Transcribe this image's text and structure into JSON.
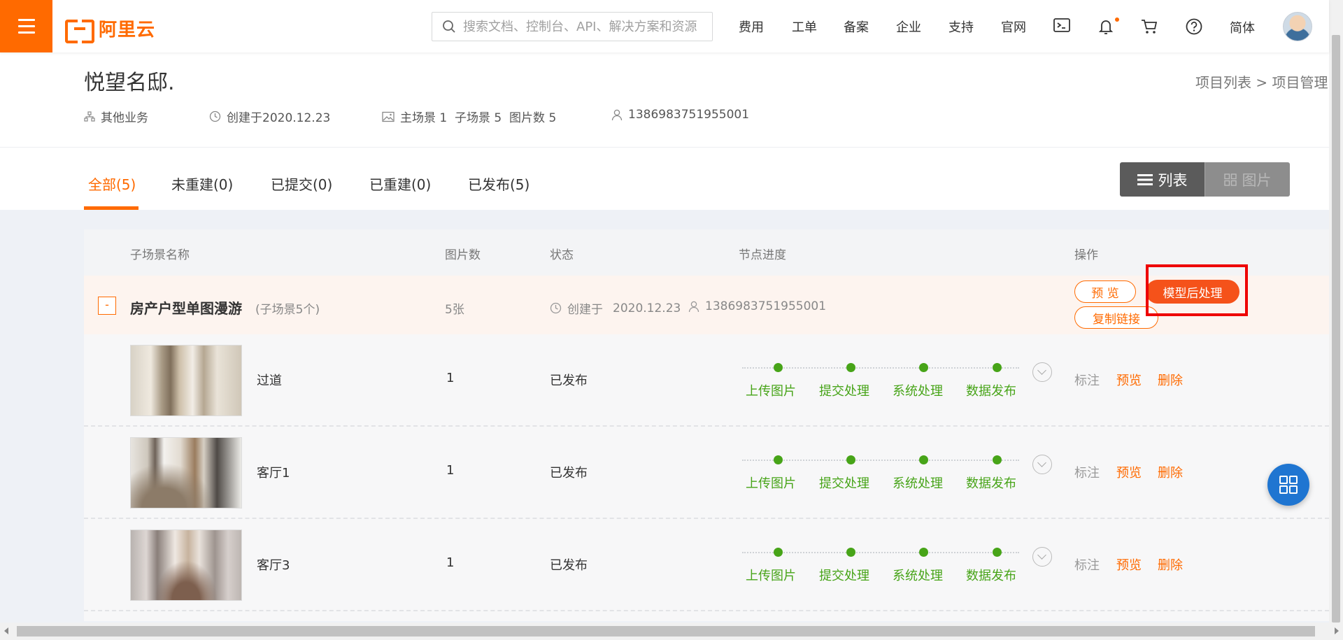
{
  "nav": {
    "logo_text": "阿里云",
    "search_placeholder": "搜索文档、控制台、API、解决方案和资源",
    "links": [
      "费用",
      "工单",
      "备案",
      "企业",
      "支持",
      "官网"
    ],
    "language": "简体",
    "icons": [
      "menu-icon",
      "search-icon",
      "terminal-icon",
      "bell-icon",
      "cart-icon",
      "help-icon",
      "avatar"
    ]
  },
  "project": {
    "title": "悦望名邸.",
    "breadcrumb": [
      "项目列表",
      ">",
      "项目管理"
    ],
    "type": "其他业务",
    "created": "创建于2020.12.23",
    "scenes": "主场景 1  子场景 5  图片数 5",
    "owner": "1386983751955001"
  },
  "tabs": {
    "items": [
      "全部(5)",
      "未重建(0)",
      "已提交(0)",
      "已重建(0)",
      "已发布(5)"
    ],
    "active": 0,
    "view_list": "列表",
    "view_grid": "图片"
  },
  "table": {
    "headers": [
      "子场景名称",
      "图片数",
      "状态",
      "节点进度",
      "操作"
    ],
    "group": {
      "toggle": "-",
      "name": "房产户型单图漫游",
      "sub": "(子场景5个)",
      "count": "5张",
      "created_label": "创建于",
      "created_date": "2020.12.23",
      "owner": "1386983751955001",
      "btn_preview": "预 览",
      "btn_model": "模型后处理",
      "btn_copy": "复制链接"
    },
    "steps": [
      "上传图片",
      "提交处理",
      "系统处理",
      "数据发布"
    ],
    "actions": [
      "标注",
      "预览",
      "删除"
    ],
    "rows": [
      {
        "name": "过道",
        "count": "1",
        "status": "已发布"
      },
      {
        "name": "客厅1",
        "count": "1",
        "status": "已发布"
      },
      {
        "name": "客厅3",
        "count": "1",
        "status": "已发布"
      }
    ]
  },
  "colors": {
    "brand": "#ff6a00",
    "success": "#47a418",
    "fab": "#1f75d1",
    "highlight": "#ee0000"
  }
}
